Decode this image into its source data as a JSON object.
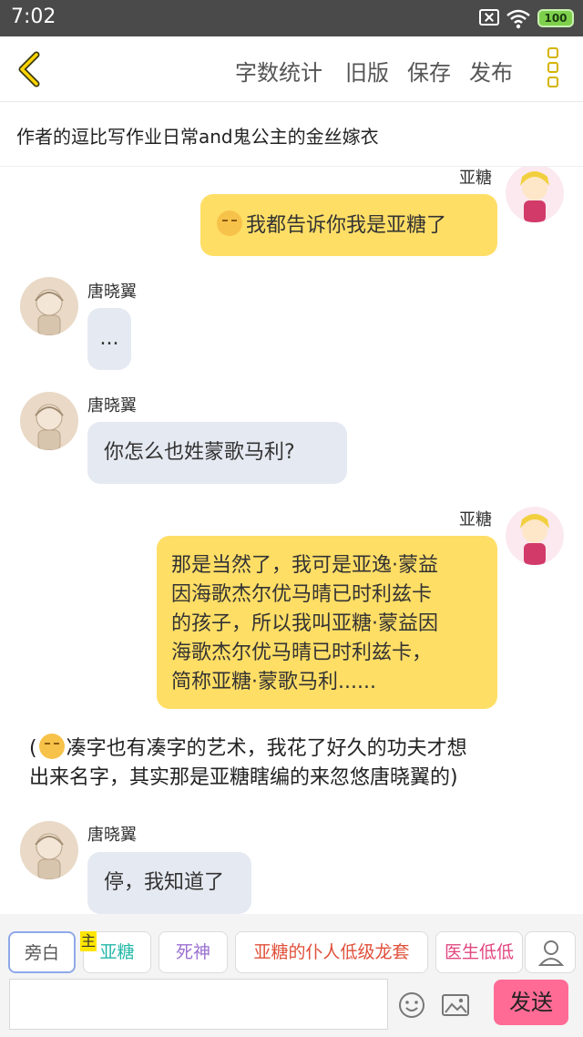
{
  "status": {
    "time": "7:02",
    "battery": "100"
  },
  "header": {
    "buttons": [
      "字数统计",
      "旧版",
      "保存",
      "发布"
    ]
  },
  "story": {
    "title": "作者的逗比写作业日常and鬼公主的金丝嫁衣"
  },
  "chat": {
    "messages": [
      {
        "speaker": "亚糖",
        "side": "right",
        "text": "我都告诉你我是亚糖了",
        "has_emoji": true
      },
      {
        "speaker": "唐晓翼",
        "side": "left",
        "text": "..."
      },
      {
        "speaker": "唐晓翼",
        "side": "left",
        "text": "你怎么也姓蒙歌马利?"
      },
      {
        "speaker": "亚糖",
        "side": "right",
        "text_lines": [
          "那是当然了，我可是亚逸·蒙益",
          "因海歌杰尔优马晴已时利兹卡",
          "的孩子，所以我叫亚糖·蒙益因",
          "海歌杰尔优马晴已时利兹卡，",
          "简称亚糖·蒙歌马利......"
        ]
      },
      {
        "speaker": "唐晓翼",
        "side": "left",
        "text": "停，我知道了"
      }
    ],
    "narration_lines": [
      "(",
      "凑字也有凑字的艺术，我花了好久的功夫才想",
      "出来名字，其实那是亚糖瞎编的来忽悠唐晓翼的)"
    ]
  },
  "characters": {
    "chips": [
      "旁白",
      "亚糖",
      "死神",
      "亚糖的仆人低级龙套",
      "医生低低"
    ],
    "chip_colors": [
      "#555555",
      "#23b8a8",
      "#9a6fd0",
      "#e0503a",
      "#e2457e"
    ],
    "main_badge": "主"
  },
  "input": {
    "placeholder": "",
    "send_label": "发送"
  },
  "colors": {
    "accent": "#ffde66",
    "send": "#ff6b95",
    "left_bubble": "#e5e9f1"
  }
}
